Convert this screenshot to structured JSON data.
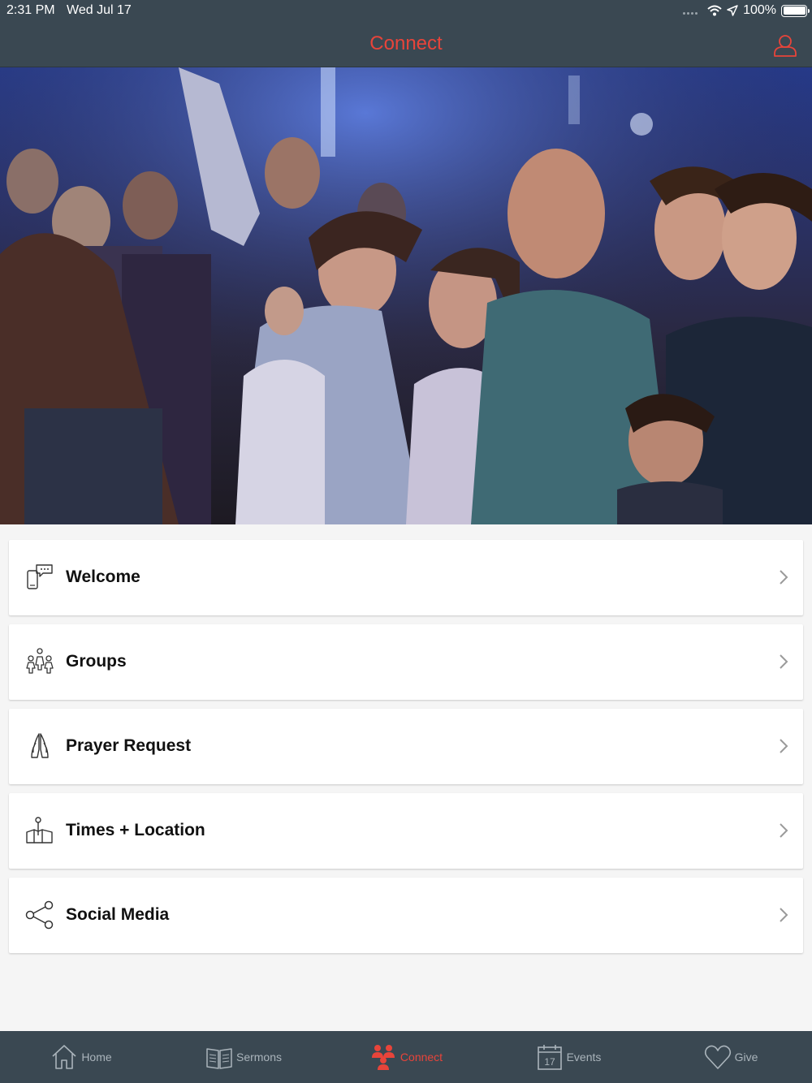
{
  "status_bar": {
    "time": "2:31 PM",
    "date": "Wed Jul 17",
    "battery": "100%"
  },
  "nav": {
    "title": "Connect",
    "profile_icon": "profile-icon"
  },
  "hero": {
    "image": "worship-congregation-photo"
  },
  "menu": {
    "items": [
      {
        "label": "Welcome",
        "icon": "phone-chat-icon"
      },
      {
        "label": "Groups",
        "icon": "groups-icon"
      },
      {
        "label": "Prayer Request",
        "icon": "praying-hands-icon"
      },
      {
        "label": "Times + Location",
        "icon": "map-pin-icon"
      },
      {
        "label": "Social Media",
        "icon": "share-icon"
      }
    ]
  },
  "tabs": [
    {
      "label": "Home",
      "icon": "home-icon",
      "active": false
    },
    {
      "label": "Sermons",
      "icon": "book-icon",
      "active": false
    },
    {
      "label": "Connect",
      "icon": "people-icon",
      "active": true
    },
    {
      "label": "Events",
      "icon": "calendar-icon",
      "calendar_day": "17",
      "active": false
    },
    {
      "label": "Give",
      "icon": "heart-icon",
      "active": false
    }
  ],
  "colors": {
    "accent": "#e8443a",
    "bar_bg": "#3a4852",
    "tab_inactive": "#aab4bb"
  }
}
